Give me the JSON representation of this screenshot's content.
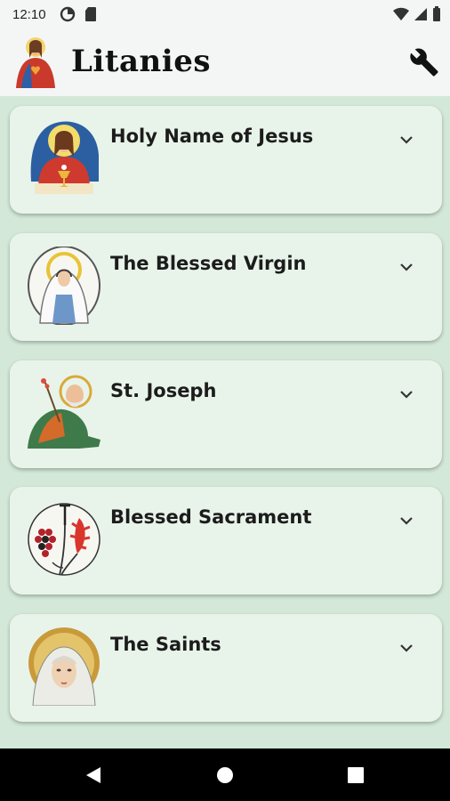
{
  "status": {
    "time": "12:10",
    "icons": [
      "data-saver-icon",
      "sd-card-icon",
      "wifi-icon",
      "signal-icon",
      "battery-icon"
    ]
  },
  "app": {
    "title": "Litanies",
    "logo": "sacred-heart-logo",
    "settings_icon": "wrench-icon"
  },
  "litanies": [
    {
      "label": "Holy Name of Jesus",
      "icon": "jesus-eucharist-image"
    },
    {
      "label": "The Blessed Virgin",
      "icon": "virgin-mary-image"
    },
    {
      "label": "St. Joseph",
      "icon": "st-joseph-image"
    },
    {
      "label": "Blessed Sacrament",
      "icon": "grapes-wheat-image"
    },
    {
      "label": "The Saints",
      "icon": "saint-portrait-image"
    }
  ],
  "nav": {
    "icons": [
      "back-icon",
      "home-icon",
      "recents-icon"
    ]
  },
  "colors": {
    "background": "#d3e8d8",
    "card": "#e8f4ea",
    "app_bar": "#f4f6f6"
  }
}
